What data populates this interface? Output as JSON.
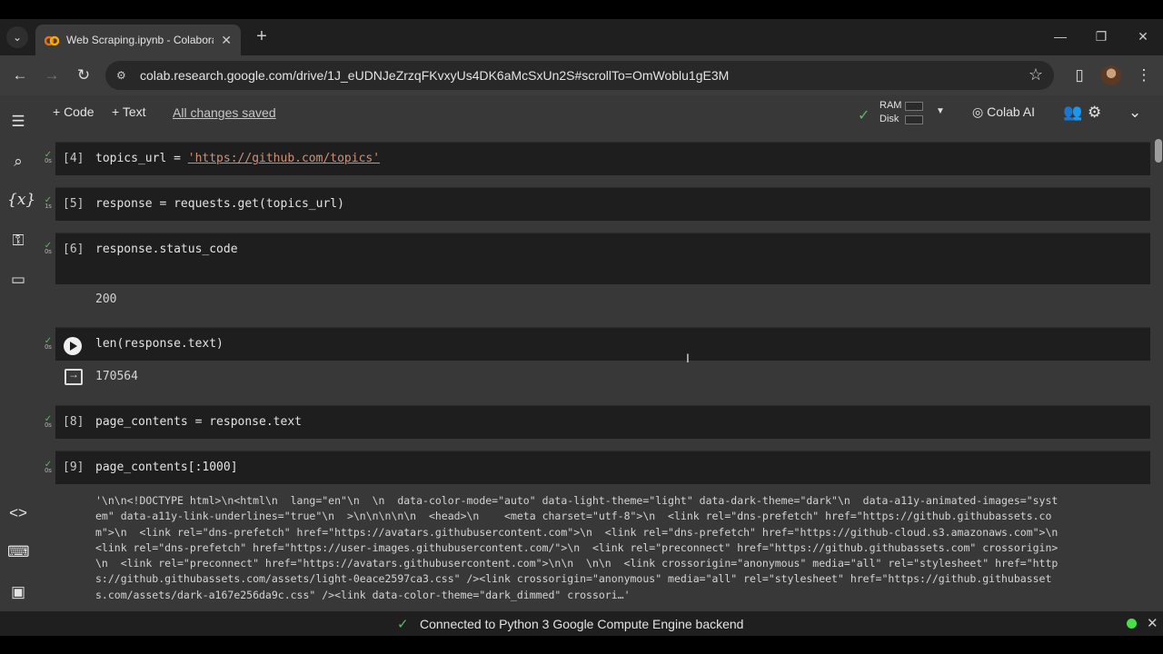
{
  "browser": {
    "tab_title": "Web Scraping.ipynb - Colaboratory",
    "url": "colab.research.google.com/drive/1J_eUDNJeZrzqFKvxyUs4DK6aMcSxUn2S#scrollTo=OmWoblu1gE3M",
    "colors": {
      "tab_bar": "#1f1f1f",
      "nav_bar": "#3c3c3c"
    }
  },
  "toolbar": {
    "add_code": "+ Code",
    "add_text": "+ Text",
    "saved_status": "All changes saved",
    "ram_label": "RAM",
    "disk_label": "Disk",
    "colab_ai": "Colab AI"
  },
  "sidebar": {
    "icons": [
      "table-of-contents-icon",
      "search-icon",
      "variables-icon",
      "secrets-key-icon",
      "files-folder-icon",
      "code-snippets-icon",
      "command-palette-icon",
      "terminal-icon"
    ]
  },
  "cells": [
    {
      "prompt": "[4]",
      "time": "0s",
      "code_pre": "topics_url = ",
      "string": "'https://github.com/topics'"
    },
    {
      "prompt": "[5]",
      "time": "1s",
      "code": "response = requests.get(topics_url)"
    },
    {
      "prompt": "[6]",
      "time": "0s",
      "code": "response.status_code",
      "output": "200"
    },
    {
      "prompt": "",
      "time": "0s",
      "code": "len(response.text)",
      "output": "170564"
    },
    {
      "prompt": "[8]",
      "time": "0s",
      "code": "page_contents = response.text"
    },
    {
      "prompt": "[9]",
      "time": "0s",
      "code": "page_contents[:1000]"
    }
  ],
  "long_output": "'\\n\\n<!DOCTYPE html>\\n<html\\n  lang=\"en\"\\n  \\n  data-color-mode=\"auto\" data-light-theme=\"light\" data-dark-theme=\"dark\"\\n  data-a11y-animated-images=\"syst\nem\" data-a11y-link-underlines=\"true\"\\n  >\\n\\n\\n\\n\\n  <head>\\n    <meta charset=\"utf-8\">\\n  <link rel=\"dns-prefetch\" href=\"https://github.githubassets.co\nm\">\\n  <link rel=\"dns-prefetch\" href=\"https://avatars.githubusercontent.com\">\\n  <link rel=\"dns-prefetch\" href=\"https://github-cloud.s3.amazonaws.com\">\\n\n<link rel=\"dns-prefetch\" href=\"https://user-images.githubusercontent.com/\">\\n  <link rel=\"preconnect\" href=\"https://github.githubassets.com\" crossorigin>\n\\n  <link rel=\"preconnect\" href=\"https://avatars.githubusercontent.com\">\\n\\n  \\n\\n  <link crossorigin=\"anonymous\" media=\"all\" rel=\"stylesheet\" href=\"http\ns://github.githubassets.com/assets/light-0eace2597ca3.css\" /><link crossorigin=\"anonymous\" media=\"all\" rel=\"stylesheet\" href=\"https://github.githubasset\ns.com/assets/dark-a167e256da9c.css\" /><link data-color-theme=\"dark_dimmed\" crossori…'",
  "status": {
    "text": "Connected to Python 3 Google Compute Engine backend",
    "dot_color": "#4ade4a"
  }
}
